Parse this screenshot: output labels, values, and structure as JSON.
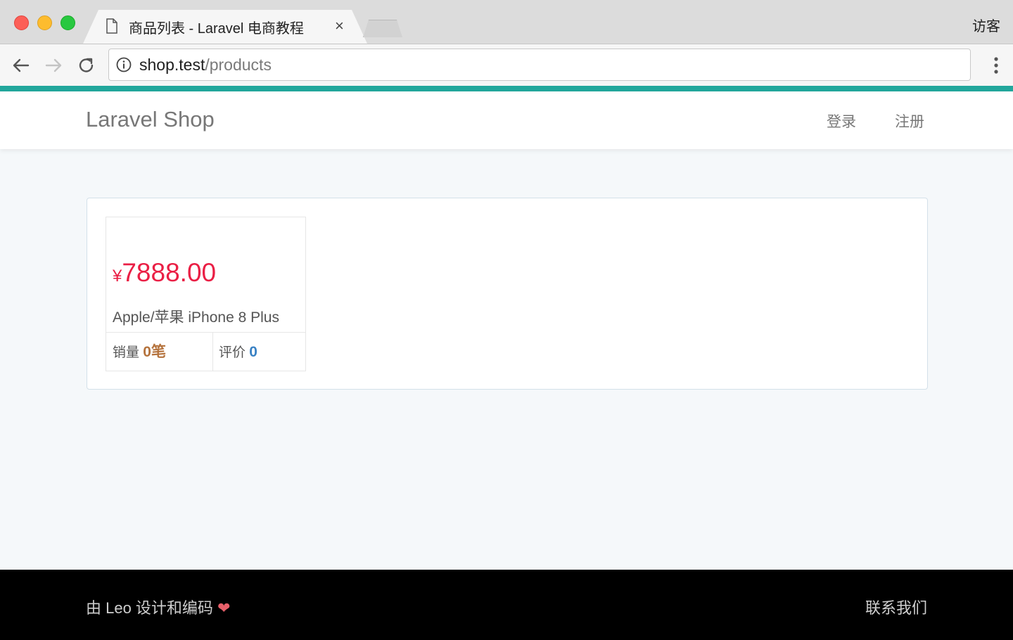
{
  "browser": {
    "tab_title": "商品列表 - Laravel 电商教程",
    "tab_close": "×",
    "guest_label": "访客",
    "url_host": "shop.test",
    "url_path": "/products"
  },
  "navbar": {
    "brand": "Laravel Shop",
    "login": "登录",
    "register": "注册"
  },
  "products": [
    {
      "price_symbol": "¥",
      "price": "7888.00",
      "title": "Apple/苹果 iPhone 8 Plus",
      "sold_label": "销量",
      "sold_count": "0笔",
      "review_label": "评价",
      "review_count": "0"
    }
  ],
  "footer": {
    "credit": "由 Leo 设计和编码",
    "heart": "❤",
    "contact": "联系我们"
  },
  "colors": {
    "accent": "#22a79c",
    "price": "#ea1f45",
    "sold_count": "#b5733d",
    "review_count": "#3a82c4",
    "footer_bg": "#000000"
  }
}
